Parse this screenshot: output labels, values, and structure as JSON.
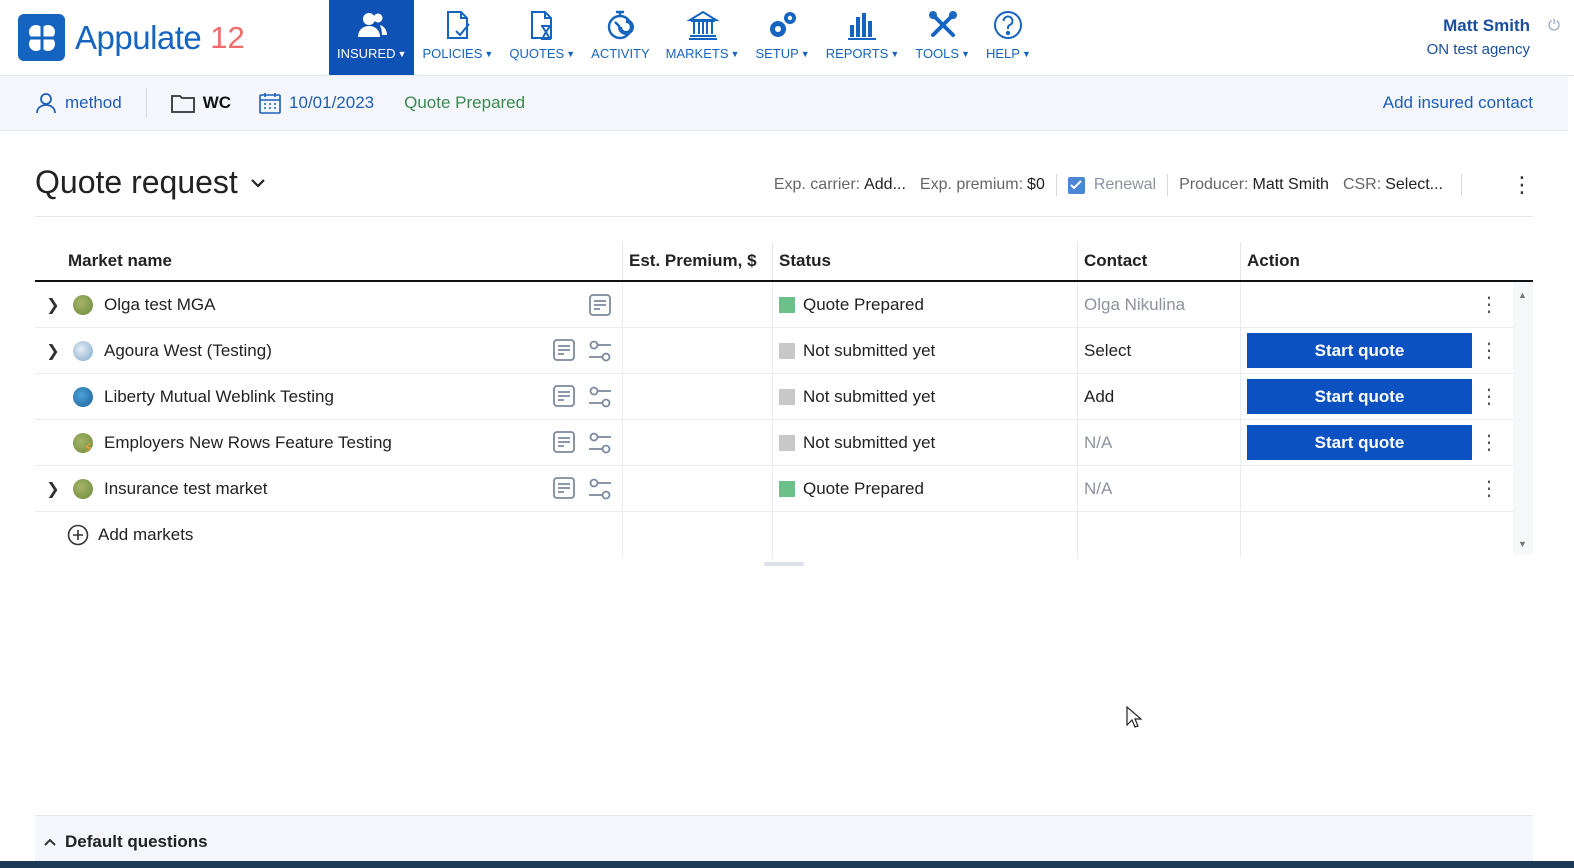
{
  "app": {
    "name": "Appulate",
    "version": "12"
  },
  "nav": [
    {
      "label": "INSURED",
      "icon": "insured-icon",
      "active": true,
      "has_menu": true
    },
    {
      "label": "POLICIES",
      "icon": "policies-icon",
      "has_menu": true
    },
    {
      "label": "QUOTES",
      "icon": "quotes-icon",
      "has_menu": true
    },
    {
      "label": "ACTIVITY",
      "icon": "activity-icon",
      "has_menu": false
    },
    {
      "label": "MARKETS",
      "icon": "markets-icon",
      "has_menu": true
    },
    {
      "label": "SETUP",
      "icon": "setup-icon",
      "has_menu": true
    },
    {
      "label": "REPORTS",
      "icon": "reports-icon",
      "has_menu": true
    },
    {
      "label": "TOOLS",
      "icon": "tools-icon",
      "has_menu": true
    },
    {
      "label": "HELP",
      "icon": "help-icon",
      "has_menu": true
    }
  ],
  "user": {
    "name": "Matt Smith",
    "agency": "ON test agency"
  },
  "subbar": {
    "insured": "method",
    "lob": "WC",
    "date": "10/01/2023",
    "status": "Quote Prepared",
    "add_contact": "Add insured contact"
  },
  "quote": {
    "title": "Quote request",
    "exp_carrier_label": "Exp. carrier:",
    "exp_carrier_value": "Add...",
    "exp_premium_label": "Exp. premium:",
    "exp_premium_value": "$0",
    "renewal_label": "Renewal",
    "producer_label": "Producer:",
    "producer_value": "Matt Smith",
    "csr_label": "CSR:",
    "csr_value": "Select..."
  },
  "table": {
    "headers": [
      "Market name",
      "Est. Premium, $",
      "Status",
      "Contact",
      "Action"
    ],
    "rows": [
      {
        "name": "Olga test MGA",
        "expandable": true,
        "status": "Quote Prepared",
        "status_color": "#6cc08a",
        "contact": "Olga Nikulina",
        "contact_muted": true,
        "action": "",
        "icons": [
          "notes-icon"
        ]
      },
      {
        "name": "Agoura West (Testing)",
        "expandable": true,
        "status": "Not submitted yet",
        "status_color": "#c8c8c8",
        "contact": "Select",
        "contact_muted": false,
        "action": "Start quote",
        "icons": [
          "notes-icon",
          "settings-sliders-icon"
        ]
      },
      {
        "name": "Liberty Mutual Weblink Testing",
        "expandable": false,
        "status": "Not submitted yet",
        "status_color": "#c8c8c8",
        "contact": "Add",
        "contact_muted": false,
        "action": "Start quote",
        "icons": [
          "notes-icon",
          "settings-sliders-icon"
        ]
      },
      {
        "name": "Employers New Rows Feature Testing",
        "expandable": false,
        "status": "Not submitted yet",
        "status_color": "#c8c8c8",
        "contact": "N/A",
        "contact_muted": true,
        "action": "Start quote",
        "icons": [
          "notes-icon",
          "settings-sliders-icon"
        ]
      },
      {
        "name": "Insurance test market",
        "expandable": true,
        "status": "Quote Prepared",
        "status_color": "#6cc08a",
        "contact": "N/A",
        "contact_muted": true,
        "action": "",
        "icons": [
          "notes-icon",
          "settings-sliders-icon"
        ]
      }
    ],
    "add_markets": "Add markets"
  },
  "footer": {
    "default_questions": "Default questions"
  },
  "colors": {
    "brand": "#1565c0",
    "nav_active": "#0d52b4",
    "button": "#0b51c1"
  }
}
